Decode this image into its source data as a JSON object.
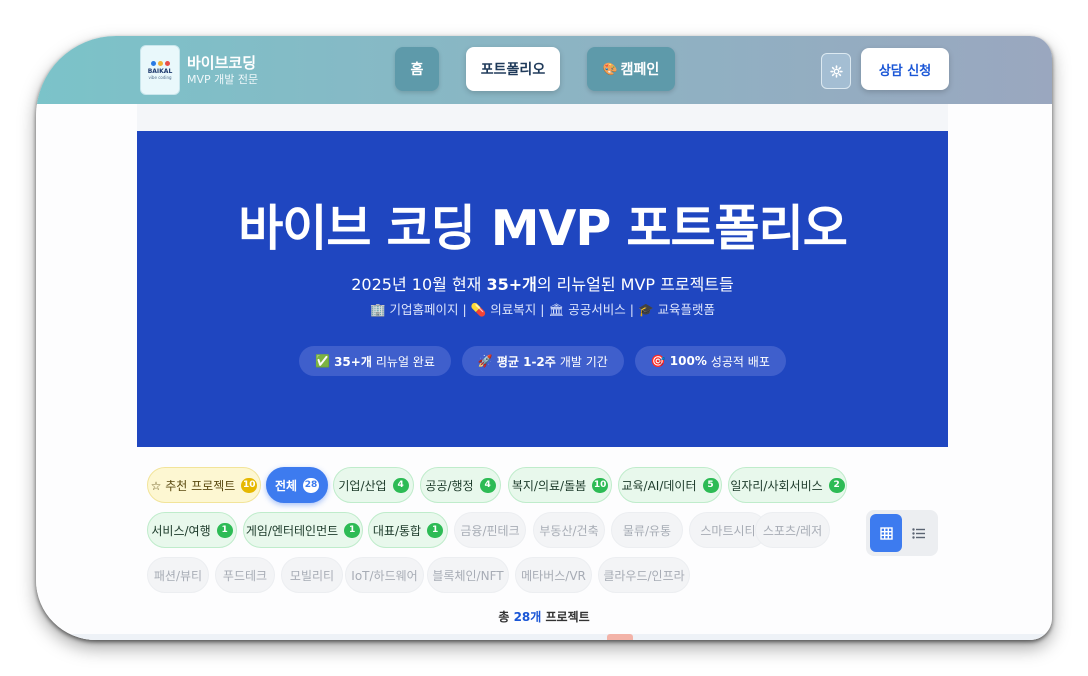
{
  "brand": {
    "logo_text": "BAIKAL",
    "logo_sub": "vibe coding",
    "name": "바이브코딩",
    "tagline": "MVP 개발 전문"
  },
  "nav": {
    "home": "홈",
    "portfolio": "포트폴리오",
    "campaign_icon": "🎨",
    "campaign": "캠페인",
    "cta": "상담 신청"
  },
  "hero": {
    "title": "바이브 코딩 MVP 포트폴리오",
    "subtitle_prefix": "2025년 10월 현재 ",
    "subtitle_highlight": "35+개",
    "subtitle_suffix": "의 리뉴얼된 MVP 프로젝트들",
    "categories": [
      {
        "icon": "🏢",
        "label": "기업홈페이지"
      },
      {
        "icon": "💊",
        "label": "의료복지"
      },
      {
        "icon": "🏛",
        "label": "공공서비스"
      },
      {
        "icon": "🎓",
        "label": "교육플랫폼"
      }
    ],
    "pills": [
      {
        "icon": "✅",
        "bold": "35+개",
        "text": "리뉴얼 완료"
      },
      {
        "icon": "🚀",
        "bold": "평균 1-2주",
        "text": "개발 기간"
      },
      {
        "icon": "🎯",
        "bold": "100%",
        "text": "성공적 배포"
      }
    ]
  },
  "filters": [
    {
      "label": "☆ 추천 프로젝트",
      "count": "10",
      "style": "yellow"
    },
    {
      "label": "전체",
      "count": "28",
      "style": "active"
    },
    {
      "label": "기업/산업",
      "count": "4",
      "style": "green"
    },
    {
      "label": "공공/행정",
      "count": "4",
      "style": "green"
    },
    {
      "label": "복지/의료/돌봄",
      "count": "10",
      "style": "green"
    },
    {
      "label": "교육/AI/데이터",
      "count": "5",
      "style": "green"
    },
    {
      "label": "일자리/사회서비스",
      "count": "2",
      "style": "green"
    },
    {
      "label": "서비스/여행",
      "count": "1",
      "style": "green"
    },
    {
      "label": "게임/엔터테인먼트",
      "count": "1",
      "style": "green"
    },
    {
      "label": "대표/통합",
      "count": "1",
      "style": "green"
    },
    {
      "label": "금융/핀테크",
      "count": "",
      "style": "grey"
    },
    {
      "label": "부동산/건축",
      "count": "",
      "style": "grey"
    },
    {
      "label": "물류/유통",
      "count": "",
      "style": "grey"
    },
    {
      "label": "스마트시티",
      "count": "",
      "style": "grey"
    },
    {
      "label": "스포츠/레저",
      "count": "",
      "style": "grey"
    },
    {
      "label": "패션/뷰티",
      "count": "",
      "style": "grey"
    },
    {
      "label": "푸드테크",
      "count": "",
      "style": "grey"
    },
    {
      "label": "모빌리티",
      "count": "",
      "style": "grey"
    },
    {
      "label": "IoT/하드웨어",
      "count": "",
      "style": "grey"
    },
    {
      "label": "블록체인/NFT",
      "count": "",
      "style": "grey"
    },
    {
      "label": "메타버스/VR",
      "count": "",
      "style": "grey"
    },
    {
      "label": "클라우드/인프라",
      "count": "",
      "style": "grey"
    }
  ],
  "total": {
    "prefix": "총 ",
    "count": "28개",
    "suffix": " 프로젝트"
  },
  "icons": {
    "settings": "gear-icon",
    "grid_view": "grid-icon",
    "list_view": "list-icon"
  }
}
